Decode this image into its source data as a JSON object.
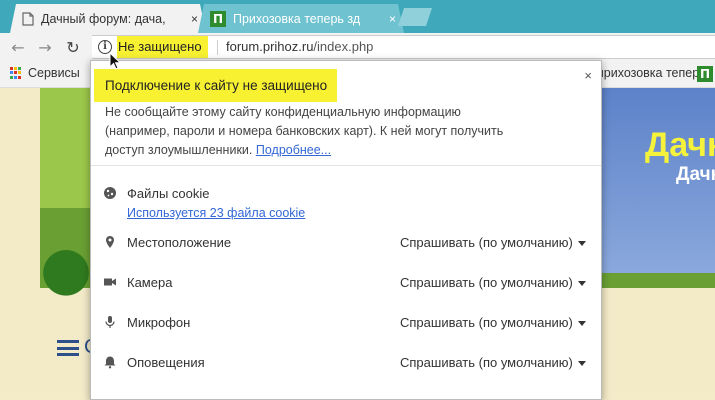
{
  "tabs": [
    {
      "title": "Дачный форум: дача,",
      "close": "×",
      "active": true
    },
    {
      "title": "Прихозовка теперь зд",
      "close": "×",
      "favicon_letter": "П",
      "active": false
    }
  ],
  "toolbar": {
    "back_icon": "←",
    "forward_icon": "→",
    "reload_icon": "↻",
    "security_label": "Не защищено",
    "info_icon": "i",
    "url_host": "forum.prihoz.ru",
    "url_path": "/index.php"
  },
  "bookmarks": {
    "apps_label": "Сервисы",
    "right_item": "прихозовка теперь",
    "right_favicon_letter": "П"
  },
  "page": {
    "banner_title": "Дачн",
    "banner_sub": "Дачн",
    "side_char": "С"
  },
  "popup": {
    "title": "Подключение к сайту не защищено",
    "close": "×",
    "message": "Не сообщайте этому сайту конфиденциальную информацию (например, пароли и номера банковских карт). К ней могут получить доступ злоумышленники.",
    "more_link": "Подробнее...",
    "cookies": {
      "label": "Файлы cookie",
      "sub": "Используется 23 файла cookie"
    },
    "permissions": [
      {
        "label": "Местоположение",
        "value": "Спрашивать (по умолчанию)",
        "icon": "location-pin-icon"
      },
      {
        "label": "Камера",
        "value": "Спрашивать (по умолчанию)",
        "icon": "camera-icon"
      },
      {
        "label": "Микрофон",
        "value": "Спрашивать (по умолчанию)",
        "icon": "microphone-icon"
      },
      {
        "label": "Оповещения",
        "value": "Спрашивать (по умолчанию)",
        "icon": "bell-icon"
      }
    ]
  },
  "colors": {
    "tabstrip": "#3fa8ba",
    "highlight": "#f7f132",
    "link": "#3367d6"
  }
}
